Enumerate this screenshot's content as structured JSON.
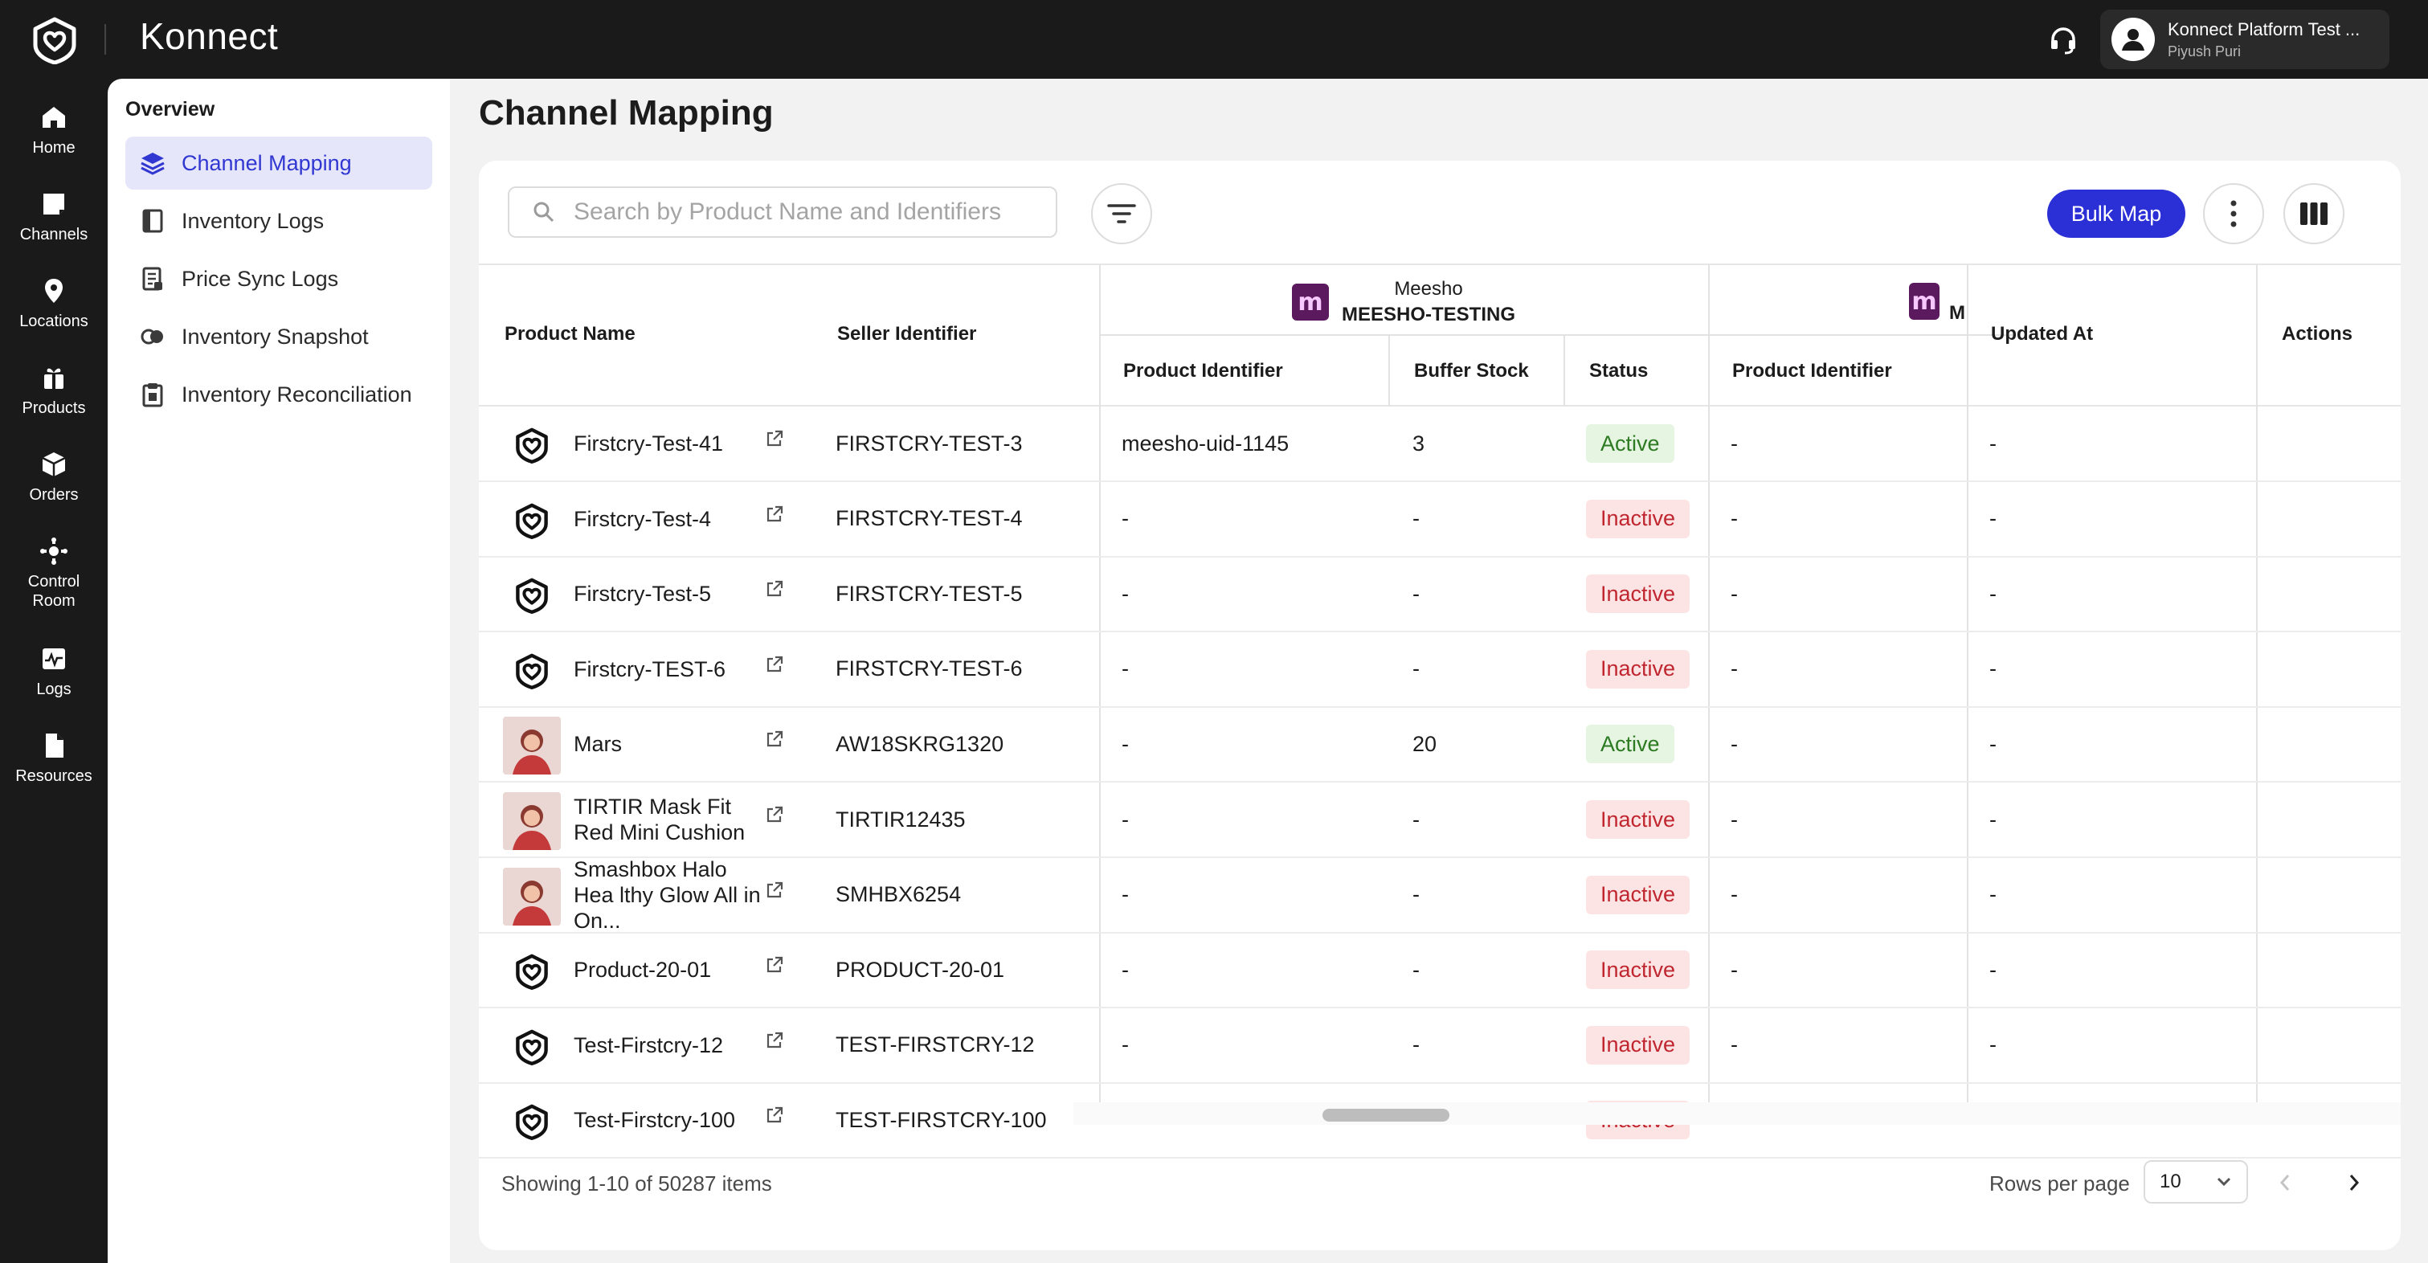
{
  "app": {
    "brand": "Konnect"
  },
  "account": {
    "name": "Konnect Platform Test ...",
    "user": "Piyush Puri"
  },
  "rail": [
    {
      "label": "Home",
      "icon": "home-icon"
    },
    {
      "label": "Channels",
      "icon": "channels-icon"
    },
    {
      "label": "Locations",
      "icon": "location-pin-icon"
    },
    {
      "label": "Products",
      "icon": "products-icon"
    },
    {
      "label": "Orders",
      "icon": "orders-box-icon"
    },
    {
      "label": "Control Room",
      "icon": "control-room-icon"
    },
    {
      "label": "Logs",
      "icon": "logs-icon"
    },
    {
      "label": "Resources",
      "icon": "resources-document-icon"
    }
  ],
  "subnav": {
    "title": "Overview",
    "items": [
      {
        "label": "Channel Mapping",
        "icon": "layers-icon",
        "active": true
      },
      {
        "label": "Inventory Logs",
        "icon": "book-icon",
        "active": false
      },
      {
        "label": "Price Sync Logs",
        "icon": "receipt-icon",
        "active": false
      },
      {
        "label": "Inventory Snapshot",
        "icon": "snapshot-icon",
        "active": false
      },
      {
        "label": "Inventory Reconciliation",
        "icon": "clipboard-icon",
        "active": false
      }
    ]
  },
  "page": {
    "title": "Channel Mapping"
  },
  "toolbar": {
    "search_placeholder": "Search by Product Name and Identifiers",
    "bulk_map_label": "Bulk Map"
  },
  "table": {
    "headers": {
      "product_name": "Product Name",
      "seller_identifier": "Seller Identifier",
      "channel_name": "Meesho",
      "channel_account": "MEESHO-TESTING",
      "channel2_account_partial": "M",
      "product_identifier": "Product Identifier",
      "buffer_stock": "Buffer Stock",
      "status": "Status",
      "product_identifier_2": "Product Identifier",
      "updated_at": "Updated At",
      "actions": "Actions"
    },
    "rows": [
      {
        "name": "Firstcry-Test-41",
        "thumb": "brand",
        "seller_id": "FIRSTCRY-TEST-3",
        "product_id": "meesho-uid-1145",
        "buffer": "3",
        "status": "Active",
        "product_id_2": "-",
        "updated": "-"
      },
      {
        "name": "Firstcry-Test-4",
        "thumb": "brand",
        "seller_id": "FIRSTCRY-TEST-4",
        "product_id": "-",
        "buffer": "-",
        "status": "Inactive",
        "product_id_2": "-",
        "updated": "-"
      },
      {
        "name": "Firstcry-Test-5",
        "thumb": "brand",
        "seller_id": "FIRSTCRY-TEST-5",
        "product_id": "-",
        "buffer": "-",
        "status": "Inactive",
        "product_id_2": "-",
        "updated": "-"
      },
      {
        "name": "Firstcry-TEST-6",
        "thumb": "brand",
        "seller_id": "FIRSTCRY-TEST-6",
        "product_id": "-",
        "buffer": "-",
        "status": "Inactive",
        "product_id_2": "-",
        "updated": "-"
      },
      {
        "name": "Mars",
        "thumb": "photo",
        "seller_id": "AW18SKRG1320",
        "product_id": "-",
        "buffer": "20",
        "status": "Active",
        "product_id_2": "-",
        "updated": "-"
      },
      {
        "name": "TIRTIR Mask Fit Red Mini Cushion",
        "thumb": "photo",
        "seller_id": "TIRTIR12435",
        "product_id": "-",
        "buffer": "-",
        "status": "Inactive",
        "product_id_2": "-",
        "updated": "-"
      },
      {
        "name": "Smashbox Halo Hea lthy Glow All in On...",
        "thumb": "photo",
        "seller_id": "SMHBX6254",
        "product_id": "-",
        "buffer": "-",
        "status": "Inactive",
        "product_id_2": "-",
        "updated": "-"
      },
      {
        "name": "Product-20-01",
        "thumb": "brand",
        "seller_id": "PRODUCT-20-01",
        "product_id": "-",
        "buffer": "-",
        "status": "Inactive",
        "product_id_2": "-",
        "updated": "-"
      },
      {
        "name": "Test-Firstcry-12",
        "thumb": "brand",
        "seller_id": "TEST-FIRSTCRY-12",
        "product_id": "-",
        "buffer": "-",
        "status": "Inactive",
        "product_id_2": "-",
        "updated": "-"
      },
      {
        "name": "Test-Firstcry-100",
        "thumb": "brand",
        "seller_id": "TEST-FIRSTCRY-100",
        "product_id": "-",
        "buffer": "-",
        "status": "Inactive",
        "product_id_2": "-",
        "updated": "-"
      }
    ]
  },
  "footer": {
    "showing": "Showing 1-10 of 50287 items",
    "rows_per_page_label": "Rows per page",
    "rows_per_page_value": "10"
  },
  "colors": {
    "accent": "#2b2fd6",
    "active_badge_bg": "#e6f4e2",
    "active_badge_text": "#2c7a21",
    "inactive_badge_bg": "#fde4e4",
    "inactive_badge_text": "#c0262f",
    "meesho_brand": "#5b1a5e"
  }
}
